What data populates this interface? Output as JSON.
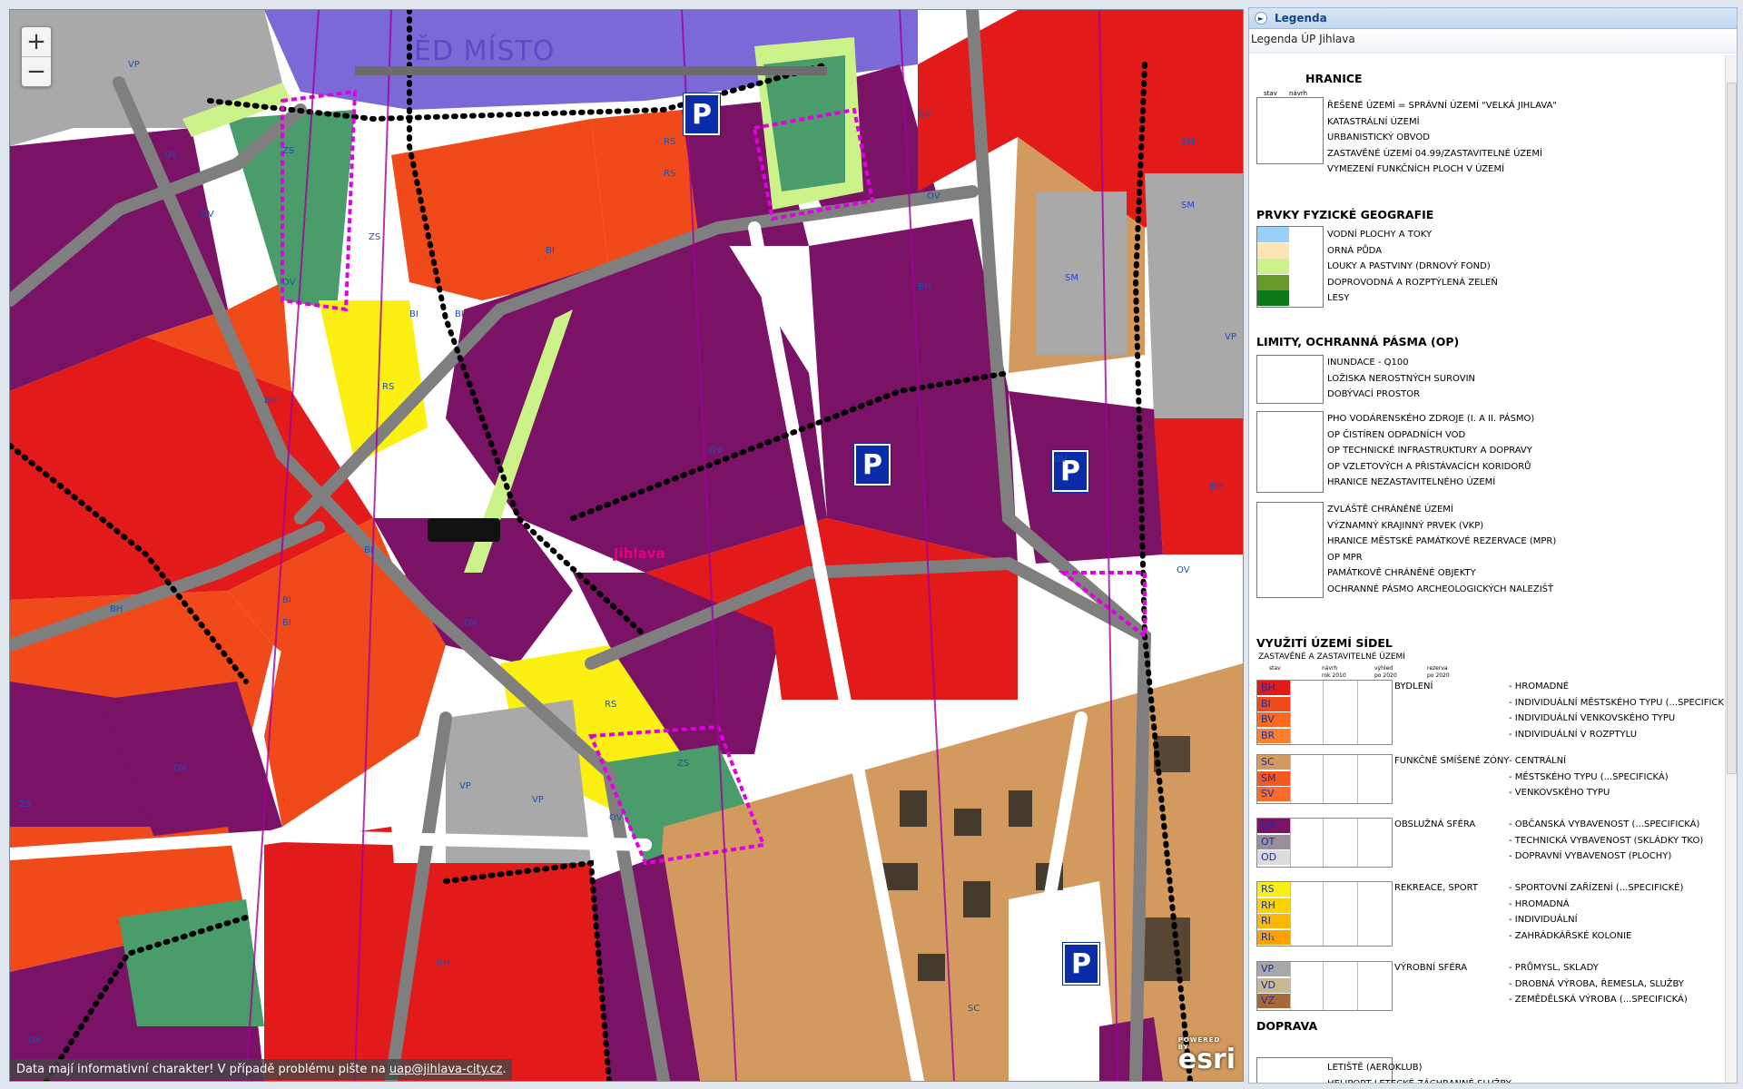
{
  "map": {
    "zoom_in": "+",
    "zoom_out": "−",
    "station_label": "ĚD MÍSTO",
    "city_label": "Jihlava",
    "parking_label": "P",
    "disclaimer_text": "Data mají informativní charakter! V případě problému pište na ",
    "disclaimer_email": "uap@jihlava-city.cz",
    "disclaimer_end": ".",
    "esri_logo": "esri",
    "esri_powered": "POWERED BY",
    "zone_labels": [
      "VP",
      "OV",
      "ZS",
      "OV",
      "RS",
      "RS",
      "OV",
      "ZS",
      "BI",
      "BI",
      "BH",
      "RS",
      "BI",
      "BH",
      "OV",
      "OV",
      "OV",
      "BI",
      "BI",
      "OV",
      "RS",
      "ZS",
      "OV",
      "VP",
      "VP",
      "BH",
      "OV",
      "ZS",
      "BI",
      "OV",
      "SM",
      "SM",
      "SM",
      "VP",
      "BH",
      "OV",
      "OV",
      "BH",
      "SC"
    ]
  },
  "legend": {
    "panel_title": "Legenda",
    "collapse_icon": "collapse-icon",
    "subtitle": "Legenda ÚP Jihlava",
    "col_stav": "stav",
    "col_navrh": "návrh",
    "hranice": {
      "title": "HRANICE",
      "items": [
        "ŘEŠENÉ ÚZEMÍ = SPRÁVNÍ ÚZEMÍ \"VELKÁ JIHLAVA\"",
        "KATASTRÁLNÍ ÚZEMÍ",
        "URBANISTICKÝ OBVOD",
        "ZASTAVĚNÉ ÚZEMÍ 04.99/ZASTAVITELNÉ ÚZEMÍ",
        "VYMEZENÍ FUNKČNÍCH PLOCH V ÚZEMÍ"
      ]
    },
    "geografie": {
      "title": "PRVKY FYZICKÉ GEOGRAFIE",
      "items": [
        {
          "label": "VODNÍ PLOCHY A TOKY",
          "color": "#9ad0f5"
        },
        {
          "label": "ORNÁ PŮDA",
          "color": "#fbe5b4"
        },
        {
          "label": "LOUKY A PASTVINY (DRNOVÝ FOND)",
          "color": "#ccf28a"
        },
        {
          "label": "DOPROVODNÁ A ROZPTÝLENÁ ZELEŇ",
          "color": "#66992a"
        },
        {
          "label": "LESY",
          "color": "#0a7a1a"
        }
      ]
    },
    "limity": {
      "title": "LIMITY, OCHRANNÁ PÁSMA (OP)",
      "group1": [
        "INUNDACE - Q100",
        "LOŽISKA NEROSTNÝCH SUROVIN",
        "DOBÝVACÍ PROSTOR"
      ],
      "group2": [
        "PHO VODÁRENSKÉHO ZDROJE (I. A II. PÁSMO)",
        "OP ČISTÍREN ODPADNÍCH VOD",
        "OP TECHNICKÉ INFRASTRUKTURY A DOPRAVY",
        "OP VZLETOVÝCH A PŘISTÁVACÍCH KORIDORŮ",
        "HRANICE NEZASTAVITELNÉHO ÚZEMÍ"
      ],
      "group3": [
        "ZVLÁŠTĚ CHRÁNĚNÉ ÚZEMÍ",
        "VÝZNAMNÝ KRAJINNÝ PRVEK (VKP)",
        "HRANICE MĚSTSKÉ PAMÁTKOVÉ REZERVACE (MPR)",
        "OP MPR",
        "PAMÁTKOVĚ CHRÁNĚNÉ OBJEKTY",
        "OCHRANNÉ PÁSMO ARCHEOLOGICKÝCH NALEZIŠŤ"
      ]
    },
    "vyuziti": {
      "title": "VYUŽITÍ ÚZEMÍ SÍDEL",
      "subtitle": "ZASTAVĚNÉ A ZASTAVITELNÉ ÚZEMÍ",
      "col_headers": [
        "stav",
        "návrh",
        "výhled",
        "rezerva"
      ],
      "col_sub": [
        "rok 2010",
        "po 2020",
        "po 2020"
      ],
      "groups": [
        {
          "name": "BYDLENÍ",
          "codes": [
            {
              "code": "BH",
              "color": "#e21a1a",
              "desc": "- HROMADNÉ"
            },
            {
              "code": "BI",
              "color": "#f04a1a",
              "desc": "- INDIVIDUÁLNÍ MĚSTSKÉHO TYPU (...SPECIFICKÉ)"
            },
            {
              "code": "BV",
              "color": "#fb6a1e",
              "desc": "- INDIVIDUÁLNÍ VENKOVSKÉHO TYPU"
            },
            {
              "code": "BR",
              "color": "#fb7f2e",
              "desc": "- INDIVIDUÁLNÍ V ROZPTYLU"
            }
          ]
        },
        {
          "name": "FUNKČNĚ SMÍŠENÉ ZÓNY",
          "codes": [
            {
              "code": "SC",
              "color": "#d29a5e",
              "desc": "- CENTRÁLNÍ"
            },
            {
              "code": "SM",
              "color": "#f5591e",
              "desc": "- MĚSTSKÉHO TYPU (...SPECIFICKÁ)"
            },
            {
              "code": "SV",
              "color": "#fb6c2a",
              "desc": "- VENKOVSKÉHO TYPU"
            }
          ]
        },
        {
          "name": "OBSLUŽNÁ SFÉRA",
          "codes": [
            {
              "code": "OV",
              "color": "#7a1266",
              "desc": "- OBČANSKÁ VYBAVENOST (...SPECIFICKÁ)"
            },
            {
              "code": "OT",
              "color": "#9b8e9c",
              "desc": "- TECHNICKÁ VYBAVENOST (SKLÁDKY TKO)"
            },
            {
              "code": "OD",
              "color": "#dcdcdc",
              "desc": "- DOPRAVNÍ VYBAVENOST (PLOCHY)"
            }
          ]
        },
        {
          "name": "REKREACE, SPORT",
          "codes": [
            {
              "code": "RS",
              "color": "#fbf011",
              "desc": "- SPORTOVNÍ ZAŘÍZENÍ (...SPECIFICKÉ)"
            },
            {
              "code": "RH",
              "color": "#fbd300",
              "desc": "- HROMADNÁ"
            },
            {
              "code": "RI",
              "color": "#fbb800",
              "desc": "- INDIVIDUÁLNÍ"
            },
            {
              "code": "RI₁",
              "color": "#fba200",
              "desc": "- ZAHRÁDKÁŘSKÉ KOLONIE"
            }
          ]
        },
        {
          "name": "VÝROBNÍ SFÉRA",
          "codes": [
            {
              "code": "VP",
              "color": "#a8a8a8",
              "desc": "- PRŮMYSL, SKLADY"
            },
            {
              "code": "VD",
              "color": "#c8b894",
              "desc": "- DROBNÁ VÝROBA, ŘEMESLA, SLUŽBY"
            },
            {
              "code": "VZ",
              "color": "#a8693a",
              "desc": "- ZEMĚDĚLSKÁ VÝROBA (...SPECIFICKÁ)"
            }
          ]
        }
      ]
    },
    "doprava": {
      "title": "DOPRAVA",
      "items": [
        "LETIŠTĚ (AEROKLUB)",
        "HELIPORT LETECKÉ ZÁCHRANNÉ SLUŽBY"
      ]
    }
  }
}
